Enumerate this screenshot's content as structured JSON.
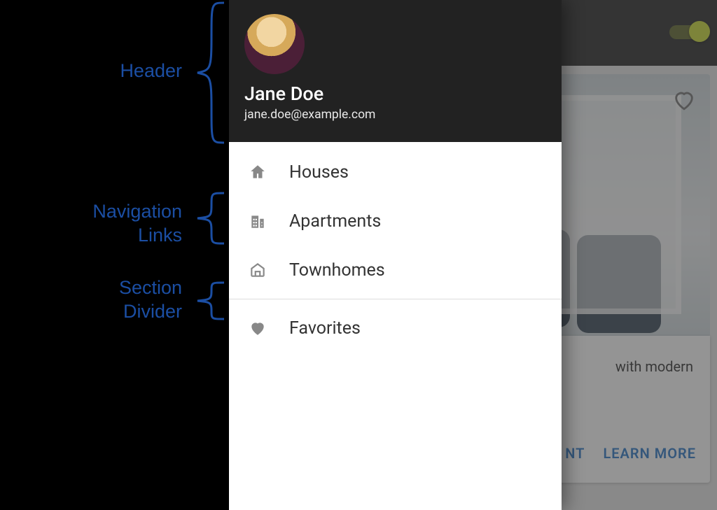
{
  "annotations": {
    "header": "Header",
    "nav_links_l1": "Navigation",
    "nav_links_l2": "Links",
    "section_l1": "Section",
    "section_l2": "Divider"
  },
  "user": {
    "name": "Jane Doe",
    "email": "jane.doe@example.com"
  },
  "drawer": {
    "items": [
      {
        "icon": "home-icon",
        "label": "Houses"
      },
      {
        "icon": "building-icon",
        "label": "Apartments"
      },
      {
        "icon": "townhome-icon",
        "label": "Townhomes"
      }
    ],
    "favorites": {
      "icon": "heart-filled-icon",
      "label": "Favorites"
    }
  },
  "card": {
    "desc_suffix": "with modern",
    "action_rent_suffix": "NT",
    "action_learn_more": "LEARN MORE"
  }
}
